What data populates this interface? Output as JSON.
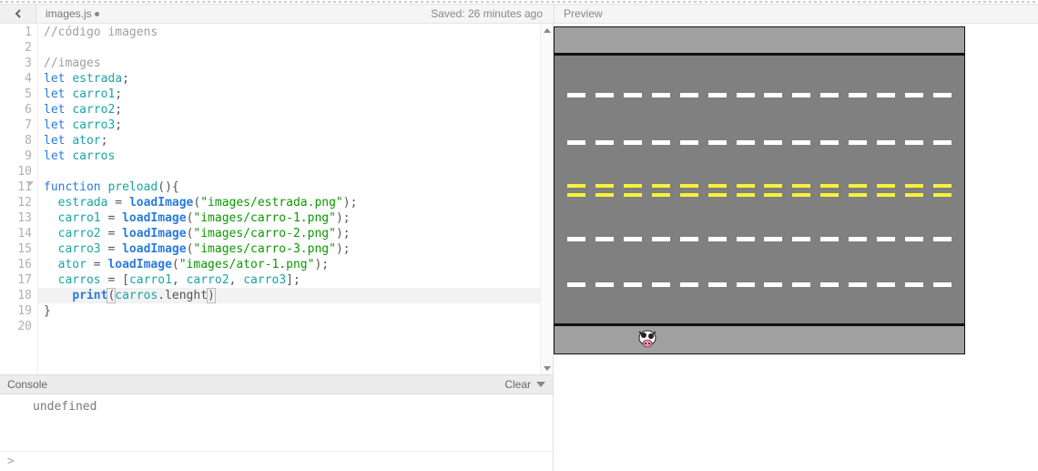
{
  "toolbar": {
    "filename": "images.js",
    "dirty": true,
    "save_status": "Saved: 26 minutes ago",
    "preview_label": "Preview"
  },
  "editor": {
    "active_line_index": 17,
    "lines": [
      {
        "n": 1,
        "tokens": [
          [
            "comment",
            "//código imagens"
          ]
        ]
      },
      {
        "n": 2,
        "tokens": [
          [
            "plain",
            ""
          ]
        ]
      },
      {
        "n": 3,
        "tokens": [
          [
            "comment",
            "//images"
          ]
        ]
      },
      {
        "n": 4,
        "tokens": [
          [
            "keyword",
            "let "
          ],
          [
            "ident",
            "estrada"
          ],
          [
            "plain",
            ";"
          ]
        ]
      },
      {
        "n": 5,
        "tokens": [
          [
            "keyword",
            "let "
          ],
          [
            "ident",
            "carro1"
          ],
          [
            "plain",
            ";"
          ]
        ]
      },
      {
        "n": 6,
        "tokens": [
          [
            "keyword",
            "let "
          ],
          [
            "ident",
            "carro2"
          ],
          [
            "plain",
            ";"
          ]
        ]
      },
      {
        "n": 7,
        "tokens": [
          [
            "keyword",
            "let "
          ],
          [
            "ident",
            "carro3"
          ],
          [
            "plain",
            ";"
          ]
        ]
      },
      {
        "n": 8,
        "tokens": [
          [
            "keyword",
            "let "
          ],
          [
            "ident",
            "ator"
          ],
          [
            "plain",
            ";"
          ]
        ]
      },
      {
        "n": 9,
        "tokens": [
          [
            "keyword",
            "let "
          ],
          [
            "ident",
            "carros"
          ]
        ]
      },
      {
        "n": 10,
        "tokens": [
          [
            "plain",
            ""
          ]
        ]
      },
      {
        "n": 11,
        "fold": true,
        "tokens": [
          [
            "keyword",
            "function "
          ],
          [
            "ident",
            "preload"
          ],
          [
            "plain",
            "(){"
          ]
        ]
      },
      {
        "n": 12,
        "tokens": [
          [
            "plain",
            "  "
          ],
          [
            "ident",
            "estrada"
          ],
          [
            "plain",
            " = "
          ],
          [
            "func",
            "loadImage"
          ],
          [
            "plain",
            "("
          ],
          [
            "string",
            "\"images/estrada.png\""
          ],
          [
            "plain",
            ");"
          ]
        ]
      },
      {
        "n": 13,
        "tokens": [
          [
            "plain",
            "  "
          ],
          [
            "ident",
            "carro1"
          ],
          [
            "plain",
            " = "
          ],
          [
            "func",
            "loadImage"
          ],
          [
            "plain",
            "("
          ],
          [
            "string",
            "\"images/carro-1.png\""
          ],
          [
            "plain",
            ");"
          ]
        ]
      },
      {
        "n": 14,
        "tokens": [
          [
            "plain",
            "  "
          ],
          [
            "ident",
            "carro2"
          ],
          [
            "plain",
            " = "
          ],
          [
            "func",
            "loadImage"
          ],
          [
            "plain",
            "("
          ],
          [
            "string",
            "\"images/carro-2.png\""
          ],
          [
            "plain",
            ");"
          ]
        ]
      },
      {
        "n": 15,
        "tokens": [
          [
            "plain",
            "  "
          ],
          [
            "ident",
            "carro3"
          ],
          [
            "plain",
            " = "
          ],
          [
            "func",
            "loadImage"
          ],
          [
            "plain",
            "("
          ],
          [
            "string",
            "\"images/carro-3.png\""
          ],
          [
            "plain",
            ");"
          ]
        ]
      },
      {
        "n": 16,
        "tokens": [
          [
            "plain",
            "  "
          ],
          [
            "ident",
            "ator"
          ],
          [
            "plain",
            " = "
          ],
          [
            "func",
            "loadImage"
          ],
          [
            "plain",
            "("
          ],
          [
            "string",
            "\"images/ator-1.png\""
          ],
          [
            "plain",
            ");"
          ]
        ]
      },
      {
        "n": 17,
        "tokens": [
          [
            "plain",
            "  "
          ],
          [
            "ident",
            "carros"
          ],
          [
            "plain",
            " = ["
          ],
          [
            "ident",
            "carro1"
          ],
          [
            "plain",
            ", "
          ],
          [
            "ident",
            "carro2"
          ],
          [
            "plain",
            ", "
          ],
          [
            "ident",
            "carro3"
          ],
          [
            "plain",
            "];"
          ]
        ]
      },
      {
        "n": 18,
        "tokens": [
          [
            "plain",
            "    "
          ],
          [
            "func",
            "print"
          ],
          [
            "bracket",
            "("
          ],
          [
            "ident",
            "carros"
          ],
          [
            "plain",
            ".lenght"
          ],
          [
            "bracket",
            ")"
          ]
        ]
      },
      {
        "n": 19,
        "tokens": [
          [
            "plain",
            "}"
          ]
        ]
      },
      {
        "n": 20,
        "tokens": [
          [
            "plain",
            ""
          ]
        ]
      }
    ]
  },
  "console": {
    "header_label": "Console",
    "clear_label": "Clear",
    "output": "undefined",
    "prompt": ">"
  },
  "preview": {
    "dash_count": 14
  }
}
